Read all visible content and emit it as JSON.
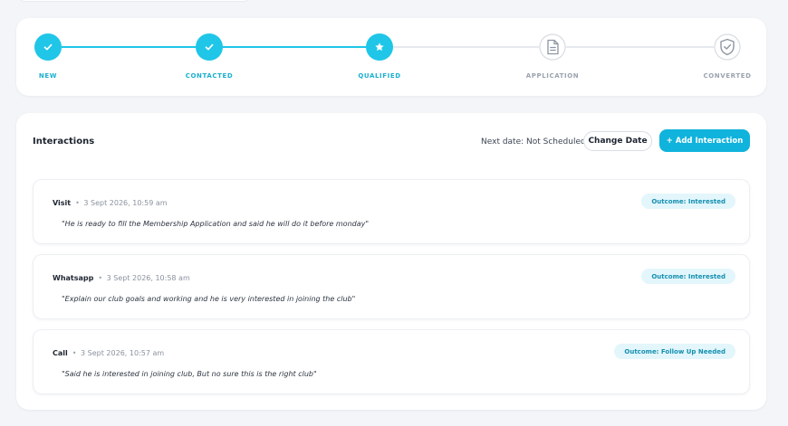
{
  "pipeline": {
    "stages": [
      {
        "label": "NEW",
        "status": "done",
        "icon": "check-icon"
      },
      {
        "label": "CONTACTED",
        "status": "done",
        "icon": "check-icon"
      },
      {
        "label": "QUALIFIED",
        "status": "current",
        "icon": "star-icon"
      },
      {
        "label": "APPLICATION",
        "status": "future",
        "icon": "document-icon"
      },
      {
        "label": "CONVERTED",
        "status": "future",
        "icon": "shield-check-icon"
      }
    ]
  },
  "interactions": {
    "title": "Interactions",
    "next_date": "Next date: Not Scheduled",
    "change_date_label": "Change Date",
    "add_label": "+ Add Interaction",
    "items": [
      {
        "type": "Visit",
        "time": "3 Sept 2026, 10:59 am",
        "note": "\"He is ready to fill the Membership Application and said he will do it before monday\"",
        "outcome": "Outcome: Interested"
      },
      {
        "type": "Whatsapp",
        "time": "3 Sept 2026, 10:58 am",
        "note": "\"Explain our club goals and working and he is very interested in joining the club\"",
        "outcome": "Outcome: Interested"
      },
      {
        "type": "Call",
        "time": "3 Sept 2026, 10:57 am",
        "note": "\"Said he is interested in joining club, But no sure this is the right club\"",
        "outcome": "Outcome: Follow Up Needed"
      }
    ]
  },
  "colors": {
    "accent": "#1fc6e8",
    "button": "#10b3dc",
    "badge_bg": "#e3f6fb",
    "badge_text": "#138fb0",
    "inactive": "#9aa3ae"
  }
}
